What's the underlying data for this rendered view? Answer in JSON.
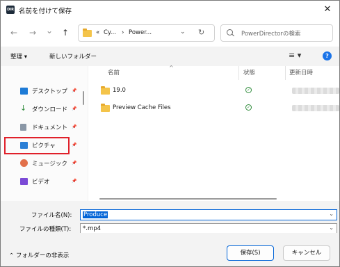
{
  "window": {
    "app_icon_text": "DIR",
    "title": "名前を付けて保存",
    "close_glyph": "✕"
  },
  "nav": {
    "back_glyph": "←",
    "forward_glyph": "→",
    "recent_glyph": "⌄",
    "up_glyph": "↑",
    "breadcrumb": [
      "«",
      "Cy...",
      "›",
      "Power..."
    ],
    "address_dropdown_glyph": "⌄",
    "refresh_glyph": "↻",
    "search_placeholder": "PowerDirectorの検索"
  },
  "toolbar": {
    "organize_label": "整理 ▾",
    "new_folder_label": "新しいフォルダー",
    "view_glyph": "≡ ▾",
    "help_glyph": "?"
  },
  "sidebar": {
    "items": [
      {
        "label": "デスクトップ",
        "icon": "desktop-icon",
        "color": "#1e7bd6"
      },
      {
        "label": "ダウンロード",
        "icon": "download-icon",
        "color": "#2e8b3a"
      },
      {
        "label": "ドキュメント",
        "icon": "document-icon",
        "color": "#6c7a8a"
      },
      {
        "label": "ピクチャ",
        "icon": "pictures-icon",
        "color": "#2b7fd6"
      },
      {
        "label": "ミュージック",
        "icon": "music-icon",
        "color": "#e2704a"
      },
      {
        "label": "ビデオ",
        "icon": "video-icon",
        "color": "#7b4ad6"
      }
    ],
    "pin_glyph": "📌",
    "highlight_color": "#e0202a"
  },
  "files": {
    "columns": [
      "名前",
      "状態",
      "更新日時"
    ],
    "sort_glyph": "^",
    "rows": [
      {
        "name": "19.0",
        "status_glyph": "✓"
      },
      {
        "name": "Preview Cache Files",
        "status_glyph": "✓"
      }
    ]
  },
  "form": {
    "filename_label": "ファイル名(N):",
    "filename_value": "Produce",
    "filetype_label": "ファイルの種類(T):",
    "filetype_value": "*.mp4",
    "dropdown_glyph": "⌄"
  },
  "footer": {
    "hide_folders_label": "⌃  フォルダーの非表示",
    "save_label": "保存(S)",
    "cancel_label": "キャンセル"
  }
}
